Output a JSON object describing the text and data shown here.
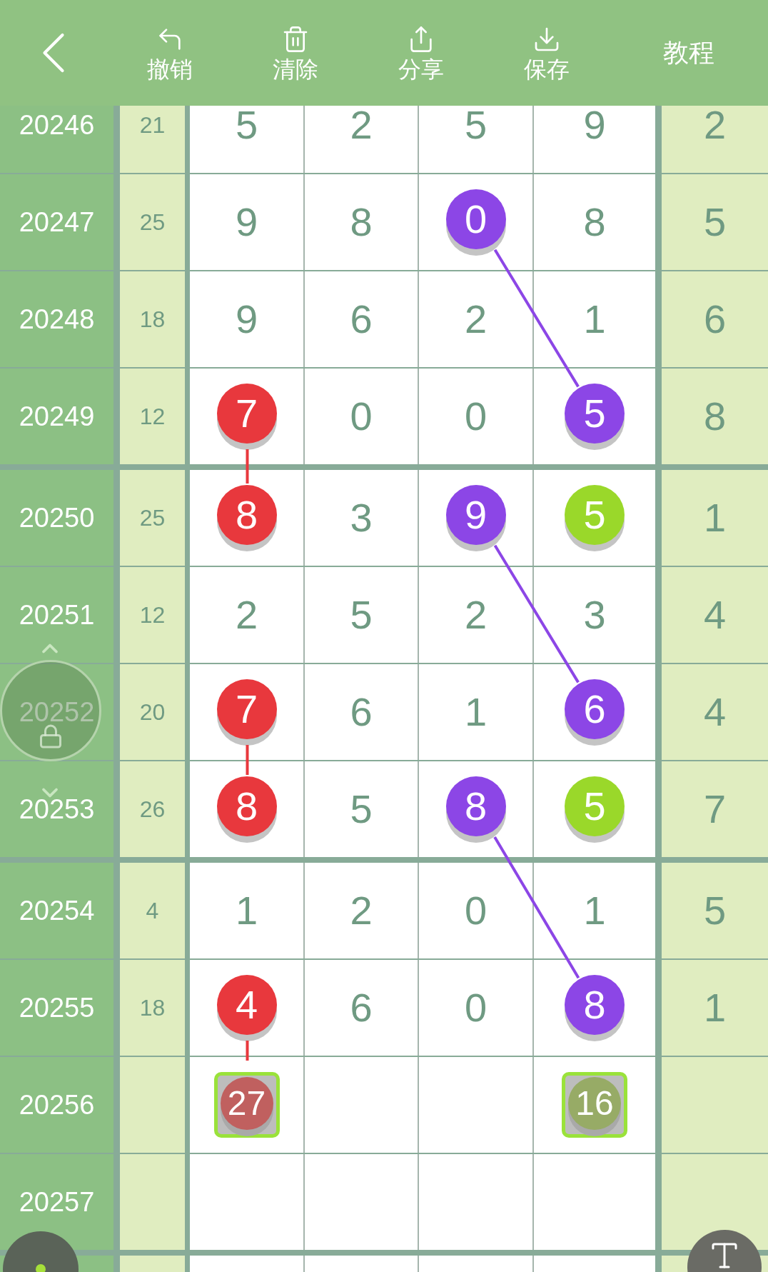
{
  "toolbar": {
    "buttons": [
      {
        "label": "撤销",
        "kind": "undo"
      },
      {
        "label": "清除",
        "kind": "clear"
      },
      {
        "label": "分享",
        "kind": "share"
      },
      {
        "label": "保存",
        "kind": "save"
      }
    ],
    "tutorial": "教程"
  },
  "rows": [
    {
      "issue": "20246",
      "sum": "21",
      "tail": "2",
      "group_end": false,
      "cells": [
        {
          "kind": "plain",
          "text": "5"
        },
        {
          "kind": "plain",
          "text": "2"
        },
        {
          "kind": "plain",
          "text": "5"
        },
        {
          "kind": "plain",
          "text": "9"
        }
      ]
    },
    {
      "issue": "20247",
      "sum": "25",
      "tail": "5",
      "group_end": false,
      "cells": [
        {
          "kind": "plain",
          "text": "9"
        },
        {
          "kind": "plain",
          "text": "8"
        },
        {
          "kind": "ball",
          "text": "0",
          "color": "#8c46e6",
          "links_down": true
        },
        {
          "kind": "plain",
          "text": "8"
        }
      ]
    },
    {
      "issue": "20248",
      "sum": "18",
      "tail": "6",
      "group_end": false,
      "cells": [
        {
          "kind": "plain",
          "text": "9"
        },
        {
          "kind": "plain",
          "text": "6"
        },
        {
          "kind": "plain",
          "text": "2"
        },
        {
          "kind": "plain",
          "text": "1"
        }
      ]
    },
    {
      "issue": "20249",
      "sum": "12",
      "tail": "8",
      "group_end": true,
      "cells": [
        {
          "kind": "ball",
          "text": "7",
          "color": "#e8383d",
          "links_down": true
        },
        {
          "kind": "plain",
          "text": "0"
        },
        {
          "kind": "plain",
          "text": "0"
        },
        {
          "kind": "ball",
          "text": "5",
          "color": "#8c46e6",
          "links_down": false
        }
      ]
    },
    {
      "issue": "20250",
      "sum": "25",
      "tail": "1",
      "group_end": false,
      "cells": [
        {
          "kind": "ball",
          "text": "8",
          "color": "#e8383d",
          "links_down": false
        },
        {
          "kind": "plain",
          "text": "3"
        },
        {
          "kind": "ball",
          "text": "9",
          "color": "#8c46e6",
          "links_down": true
        },
        {
          "kind": "ball",
          "text": "5",
          "color": "#9ad82a",
          "links_down": false
        }
      ]
    },
    {
      "issue": "20251",
      "sum": "12",
      "tail": "4",
      "group_end": false,
      "cells": [
        {
          "kind": "plain",
          "text": "2"
        },
        {
          "kind": "plain",
          "text": "5"
        },
        {
          "kind": "plain",
          "text": "2"
        },
        {
          "kind": "plain",
          "text": "3"
        }
      ]
    },
    {
      "issue": "20252",
      "sum": "20",
      "tail": "4",
      "group_end": false,
      "cells": [
        {
          "kind": "ball",
          "text": "7",
          "color": "#e8383d",
          "links_down": true
        },
        {
          "kind": "plain",
          "text": "6"
        },
        {
          "kind": "plain",
          "text": "1"
        },
        {
          "kind": "ball",
          "text": "6",
          "color": "#8c46e6",
          "links_down": false
        }
      ]
    },
    {
      "issue": "20253",
      "sum": "26",
      "tail": "7",
      "group_end": true,
      "cells": [
        {
          "kind": "ball",
          "text": "8",
          "color": "#e8383d",
          "links_down": false
        },
        {
          "kind": "plain",
          "text": "5"
        },
        {
          "kind": "ball",
          "text": "8",
          "color": "#8c46e6",
          "links_down": true
        },
        {
          "kind": "ball",
          "text": "5",
          "color": "#9ad82a",
          "links_down": false
        }
      ]
    },
    {
      "issue": "20254",
      "sum": "4",
      "tail": "5",
      "group_end": false,
      "cells": [
        {
          "kind": "plain",
          "text": "1"
        },
        {
          "kind": "plain",
          "text": "2"
        },
        {
          "kind": "plain",
          "text": "0"
        },
        {
          "kind": "plain",
          "text": "1"
        }
      ]
    },
    {
      "issue": "20255",
      "sum": "18",
      "tail": "1",
      "group_end": false,
      "cells": [
        {
          "kind": "ball",
          "text": "4",
          "color": "#e8383d",
          "links_down": true
        },
        {
          "kind": "plain",
          "text": "6"
        },
        {
          "kind": "plain",
          "text": "0"
        },
        {
          "kind": "ball",
          "text": "8",
          "color": "#8c46e6",
          "links_down": false
        }
      ]
    },
    {
      "issue": "20256",
      "group_end": false,
      "cells": [
        {
          "kind": "pending",
          "text": "27",
          "color": "#c0605f"
        },
        {
          "kind": "empty"
        },
        {
          "kind": "empty"
        },
        {
          "kind": "pending",
          "text": "16",
          "color": "#97ab66"
        }
      ]
    },
    {
      "issue": "20257",
      "group_end": true,
      "cells": [
        {
          "kind": "empty"
        },
        {
          "kind": "empty"
        },
        {
          "kind": "empty"
        },
        {
          "kind": "empty"
        }
      ]
    },
    {
      "group_end": false,
      "cells": [
        {
          "kind": "empty"
        },
        {
          "kind": "empty"
        },
        {
          "kind": "empty"
        },
        {
          "kind": "empty"
        }
      ]
    }
  ]
}
